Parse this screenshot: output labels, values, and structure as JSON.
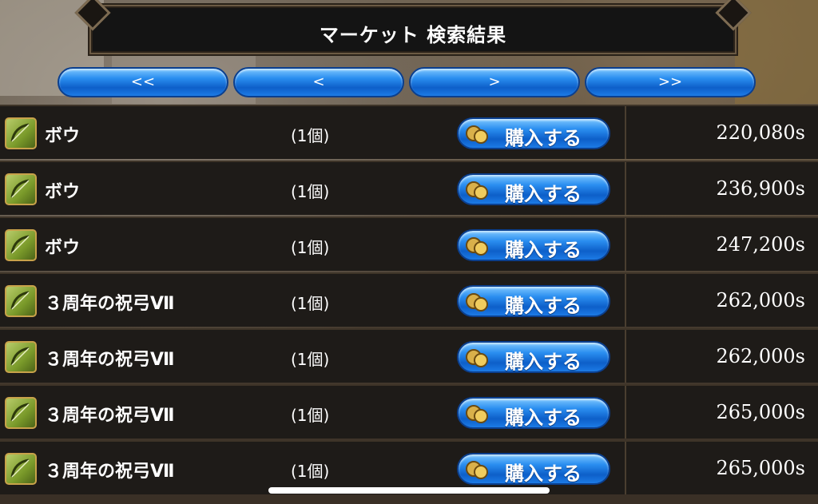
{
  "header": {
    "title": "マーケット 検索結果"
  },
  "nav": {
    "first_label": "<<",
    "prev_label": "<",
    "next_label": ">",
    "last_label": ">>"
  },
  "buy_label": "購入する",
  "rows": [
    {
      "name": "ボウ",
      "qty": "(1個)",
      "price": "220,080s",
      "icon": "bow-icon"
    },
    {
      "name": "ボウ",
      "qty": "(1個)",
      "price": "236,900s",
      "icon": "bow-icon"
    },
    {
      "name": "ボウ",
      "qty": "(1個)",
      "price": "247,200s",
      "icon": "bow-icon"
    },
    {
      "name": "３周年の祝弓Ⅶ",
      "qty": "(1個)",
      "price": "262,000s",
      "icon": "bow-icon"
    },
    {
      "name": "３周年の祝弓Ⅶ",
      "qty": "(1個)",
      "price": "262,000s",
      "icon": "bow-icon"
    },
    {
      "name": "３周年の祝弓Ⅶ",
      "qty": "(1個)",
      "price": "265,000s",
      "icon": "bow-icon"
    },
    {
      "name": "３周年の祝弓Ⅶ",
      "qty": "(1個)",
      "price": "265,000s",
      "icon": "bow-icon"
    }
  ],
  "colors": {
    "button_blue": "#1c7be6",
    "row_bg": "#1e1b18",
    "icon_green": "#7a9a2a"
  }
}
